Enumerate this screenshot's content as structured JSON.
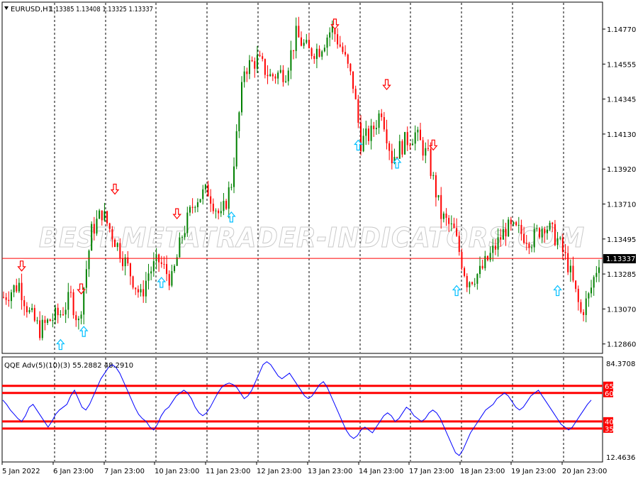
{
  "header": {
    "symbol_tf": "EURUSD,H1",
    "ohlc": "1.13385 1.13408 1.13325 1.13337"
  },
  "indicator": {
    "label": "QQE Adv(5)(10)(3) 55.2882 48.2910",
    "ymax_label": "84.3708",
    "ymin_label": "12.4636",
    "levels": [
      65,
      60,
      40,
      35
    ],
    "level_color": "#ff0000",
    "line_color": "#0000ff"
  },
  "watermark": "BEST-METATRADER-INDICATORS.COM",
  "price_axis": {
    "ticks": [
      "1.14770",
      "1.14555",
      "1.14345",
      "1.14130",
      "1.13920",
      "1.13710",
      "1.13495",
      "1.13285",
      "1.13070",
      "1.12860"
    ],
    "current": "1.13337"
  },
  "time_axis": [
    "5 Jan 2022",
    "6 Jan 23:00",
    "7 Jan 23:00",
    "10 Jan 23:00",
    "11 Jan 23:00",
    "12 Jan 23:00",
    "13 Jan 23:00",
    "14 Jan 23:00",
    "17 Jan 23:00",
    "18 Jan 23:00",
    "19 Jan 23:00",
    "20 Jan 23:00"
  ],
  "colors": {
    "bull": "#008000",
    "bear": "#ff0000",
    "buy_arrow": "#00bfff",
    "sell_arrow": "#ff0000",
    "grid": "#000000",
    "current_line": "#ff0000"
  },
  "chart_data": [
    {
      "type": "candlestick",
      "title": "EURUSD,H1",
      "ylim": [
        1.1276,
        1.149
      ],
      "current_price": 1.13337,
      "close_path": [
        [
          0,
          1.131
        ],
        [
          6,
          1.1318
        ],
        [
          10,
          1.13
        ],
        [
          14,
          1.129
        ],
        [
          18,
          1.1296
        ],
        [
          22,
          1.13
        ],
        [
          26,
          1.131
        ],
        [
          29,
          1.1294
        ],
        [
          34,
          1.135
        ],
        [
          38,
          1.1362
        ],
        [
          43,
          1.1345
        ],
        [
          48,
          1.1328
        ],
        [
          53,
          1.131
        ],
        [
          56,
          1.1325
        ],
        [
          60,
          1.1332
        ],
        [
          65,
          1.132
        ],
        [
          69,
          1.1348
        ],
        [
          74,
          1.137
        ],
        [
          79,
          1.1375
        ],
        [
          84,
          1.1358
        ],
        [
          88,
          1.138
        ],
        [
          93,
          1.145
        ],
        [
          98,
          1.1455
        ],
        [
          103,
          1.1445
        ],
        [
          109,
          1.1448
        ],
        [
          113,
          1.147
        ],
        [
          118,
          1.146
        ],
        [
          122,
          1.1462
        ],
        [
          127,
          1.1475
        ],
        [
          131,
          1.146
        ],
        [
          135,
          1.144
        ],
        [
          138,
          1.1405
        ],
        [
          142,
          1.141
        ],
        [
          146,
          1.1425
        ],
        [
          150,
          1.1395
        ],
        [
          155,
          1.1405
        ],
        [
          159,
          1.141
        ],
        [
          164,
          1.1395
        ],
        [
          169,
          1.136
        ],
        [
          174,
          1.135
        ],
        [
          179,
          1.132
        ],
        [
          184,
          1.1325
        ],
        [
          189,
          1.1338
        ],
        [
          194,
          1.1352
        ],
        [
          199,
          1.135
        ],
        [
          204,
          1.1345
        ],
        [
          209,
          1.1355
        ],
        [
          214,
          1.1345
        ],
        [
          218,
          1.133
        ],
        [
          223,
          1.13
        ],
        [
          226,
          1.131
        ],
        [
          230,
          1.1333
        ]
      ],
      "buy_arrows": [
        [
          22,
          1.1284
        ],
        [
          31,
          1.1292
        ],
        [
          88,
          1.1362
        ],
        [
          61,
          1.1322
        ],
        [
          137,
          1.1406
        ],
        [
          152,
          1.1395
        ],
        [
          175,
          1.1317
        ],
        [
          214,
          1.1317
        ]
      ],
      "sell_arrows": [
        [
          7,
          1.1326
        ],
        [
          30,
          1.1312
        ],
        [
          43,
          1.1373
        ],
        [
          67,
          1.1358
        ],
        [
          128,
          1.1474
        ],
        [
          148,
          1.1437
        ],
        [
          166,
          1.14
        ]
      ]
    },
    {
      "type": "line",
      "title": "QQE Adv(5)(10)(3)",
      "ylim": [
        12.4636,
        84.3708
      ],
      "levels": [
        65,
        60,
        40,
        35
      ],
      "series": [
        {
          "name": "QQE",
          "values": [
            55,
            52,
            48,
            45,
            42,
            40,
            44,
            50,
            52,
            48,
            44,
            40,
            36,
            40,
            45,
            48,
            50,
            52,
            58,
            62,
            56,
            50,
            48,
            52,
            58,
            64,
            70,
            74,
            78,
            80,
            78,
            74,
            68,
            62,
            56,
            50,
            45,
            42,
            40,
            36,
            34,
            38,
            44,
            48,
            50,
            54,
            58,
            60,
            62,
            60,
            56,
            50,
            46,
            44,
            46,
            50,
            55,
            60,
            64,
            66,
            67,
            66,
            64,
            60,
            56,
            58,
            62,
            68,
            74,
            80,
            82,
            80,
            76,
            72,
            70,
            72,
            74,
            70,
            66,
            62,
            58,
            56,
            58,
            62,
            66,
            68,
            64,
            58,
            52,
            46,
            40,
            34,
            30,
            28,
            30,
            34,
            36,
            34,
            32,
            36,
            40,
            44,
            46,
            44,
            40,
            42,
            46,
            50,
            48,
            44,
            42,
            40,
            42,
            46,
            48,
            46,
            42,
            36,
            30,
            24,
            18,
            16,
            20,
            26,
            32,
            36,
            40,
            44,
            48,
            50,
            52,
            56,
            58,
            60,
            58,
            54,
            50,
            48,
            50,
            54,
            58,
            60,
            62,
            58,
            54,
            50,
            46,
            42,
            38,
            36,
            34,
            36,
            40,
            44,
            48,
            52,
            55
          ]
        }
      ]
    }
  ]
}
